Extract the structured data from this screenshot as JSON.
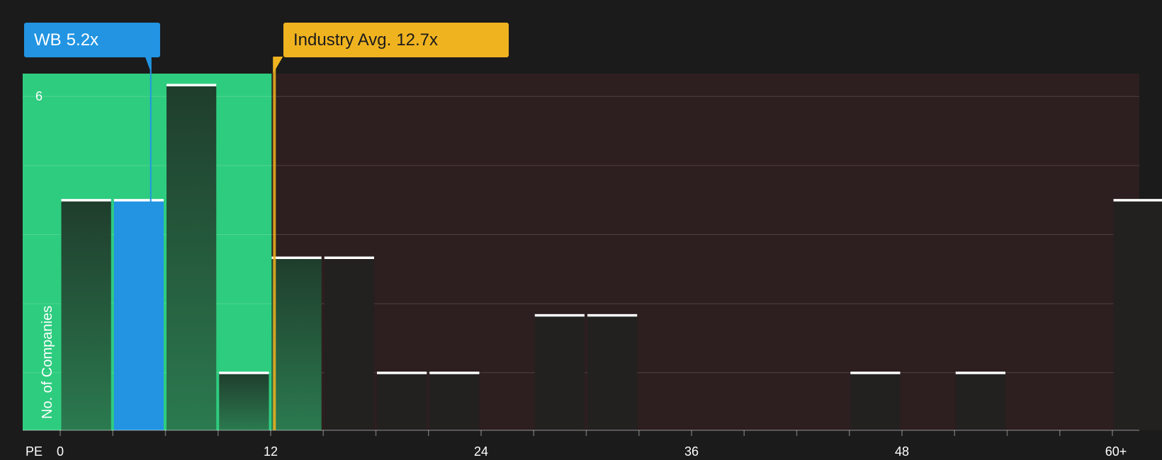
{
  "company_label": "WB",
  "company_value": "5.2x",
  "industry_label": "Industry Avg.",
  "industry_value": "12.7x",
  "y_axis_title": "No. of Companies",
  "y_top_label": "6",
  "x_axis_name": "PE",
  "colors": {
    "background": "#1b1b1b",
    "below_zone": "#2ecc7f",
    "above_zone": "#2d1e1f",
    "company": "#2294e2",
    "industry": "#f0b320",
    "bar_in_green": "#224a35",
    "bar_in_red": "#232020",
    "bar_cap": "#ffffff"
  },
  "chart_data": {
    "type": "bar",
    "title": "",
    "xlabel": "PE",
    "ylabel": "No. of Companies",
    "xlim": [
      0,
      60
    ],
    "ylim": [
      0,
      6
    ],
    "x_ticks": [
      0,
      12,
      24,
      36,
      48,
      60
    ],
    "x_tick_labels": [
      "0",
      "12",
      "24",
      "36",
      "48",
      "60+"
    ],
    "bin_width": 3,
    "bins": [
      {
        "start": 0,
        "count": 4
      },
      {
        "start": 3,
        "count": 4
      },
      {
        "start": 6,
        "count": 6
      },
      {
        "start": 9,
        "count": 1
      },
      {
        "start": 12,
        "count": 3
      },
      {
        "start": 15,
        "count": 3
      },
      {
        "start": 18,
        "count": 1
      },
      {
        "start": 21,
        "count": 1
      },
      {
        "start": 24,
        "count": 0
      },
      {
        "start": 27,
        "count": 2
      },
      {
        "start": 30,
        "count": 2
      },
      {
        "start": 33,
        "count": 0
      },
      {
        "start": 36,
        "count": 0
      },
      {
        "start": 39,
        "count": 0
      },
      {
        "start": 42,
        "count": 0
      },
      {
        "start": 45,
        "count": 1
      },
      {
        "start": 48,
        "count": 0
      },
      {
        "start": 51,
        "count": 1
      },
      {
        "start": 54,
        "count": 0
      },
      {
        "start": 57,
        "count": 0
      },
      {
        "start": 60,
        "count": 4
      }
    ],
    "highlight_bin_start": 3,
    "company_pe": 5.2,
    "industry_avg_pe": 12.7,
    "grid": true
  }
}
